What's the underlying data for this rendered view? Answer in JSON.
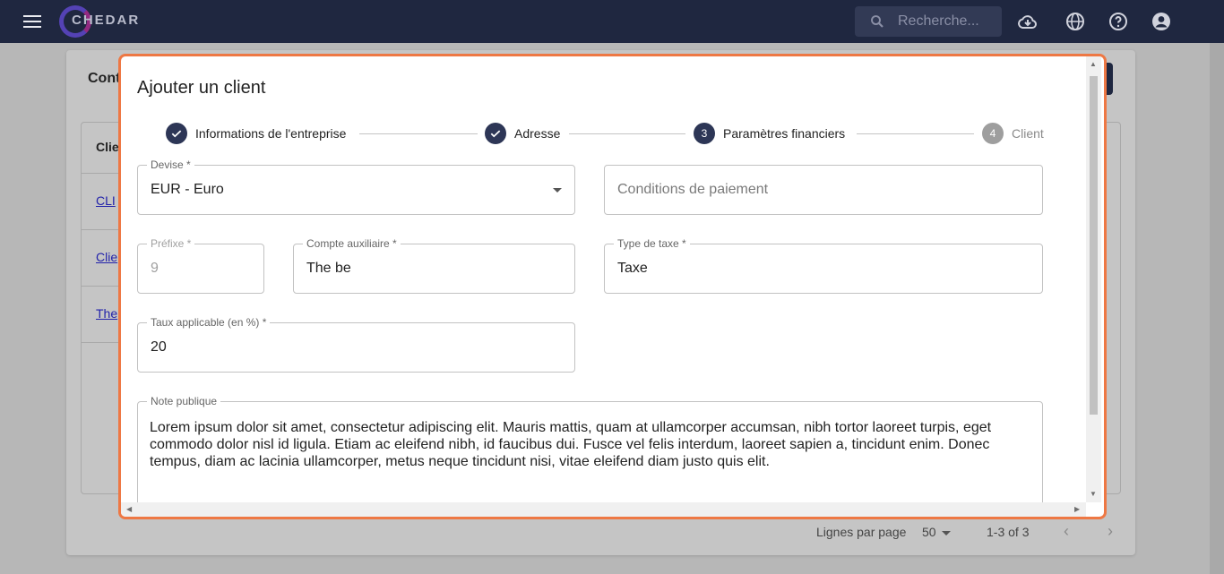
{
  "appbar": {
    "logo_text": "CHEDAR",
    "search_placeholder": "Recherche...",
    "icons": [
      "menu-icon",
      "cloud-download-icon",
      "globe-icon",
      "help-icon",
      "account-icon"
    ]
  },
  "background": {
    "page_title": "Conta",
    "column_header": "Clien",
    "rows": [
      "CLI",
      "Clie",
      "The"
    ],
    "pager": {
      "rows_label": "Lignes par page",
      "rows_value": "50",
      "range": "1-3 of 3"
    }
  },
  "modal": {
    "title": "Ajouter un client",
    "steps": [
      {
        "label": "Informations de l'entreprise",
        "state": "done",
        "number": "1"
      },
      {
        "label": "Adresse",
        "state": "done",
        "number": "2"
      },
      {
        "label": "Paramètres financiers",
        "state": "active",
        "number": "3"
      },
      {
        "label": "Client",
        "state": "inactive",
        "number": "4"
      }
    ],
    "fields": {
      "currency": {
        "label": "Devise *",
        "value": "EUR - Euro"
      },
      "payment_terms": {
        "placeholder": "Conditions de paiement"
      },
      "prefix": {
        "label": "Préfixe *",
        "value": "9"
      },
      "aux_account": {
        "label": "Compte auxiliaire *",
        "value": "The be"
      },
      "tax_type": {
        "label": "Type de taxe *",
        "value": "Taxe"
      },
      "rate": {
        "label": "Taux applicable (en %) *",
        "value": "20"
      },
      "public_note": {
        "label": "Note publique",
        "value": "Lorem ipsum dolor sit amet, consectetur adipiscing elit. Mauris mattis, quam at ullamcorper accumsan, nibh tortor laoreet turpis, eget commodo dolor nisl id ligula. Etiam ac eleifend nibh, id faucibus dui. Fusce vel felis interdum, laoreet sapien a, tincidunt enim. Donec tempus, diam ac lacinia ullamcorper, metus neque tincidunt nisi, vitae eleifend diam justo quis elit."
      }
    }
  },
  "colors": {
    "appbar": "#1f2740",
    "accent": "#2d3656",
    "modal_border": "#ee7844"
  }
}
